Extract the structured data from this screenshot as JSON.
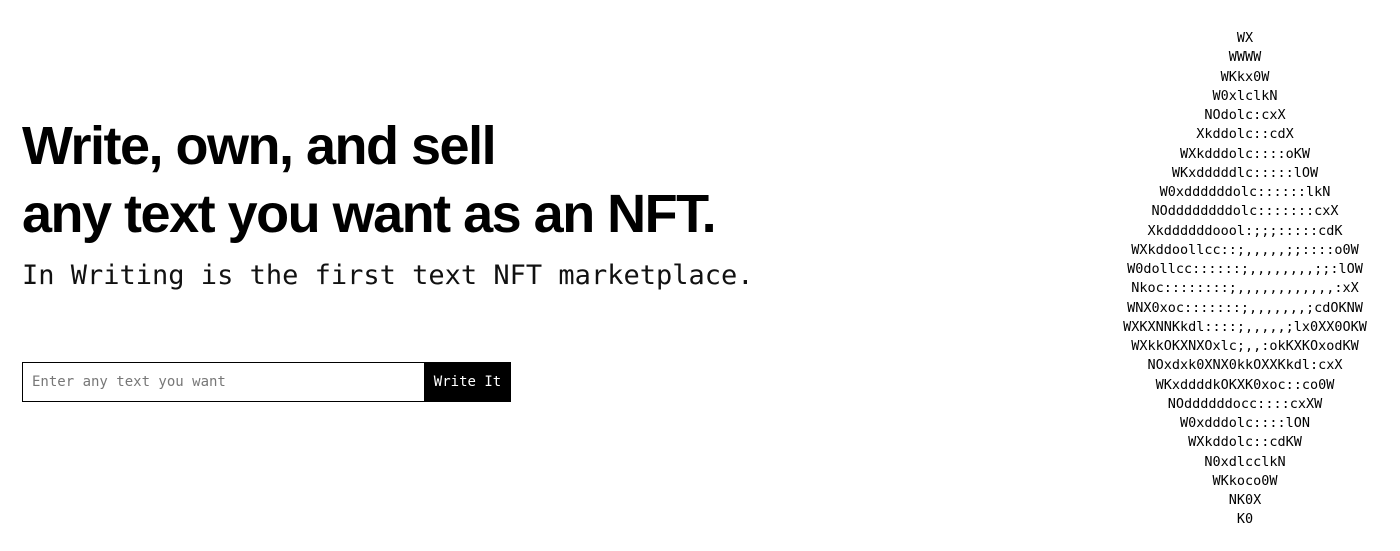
{
  "hero": {
    "headline_line1": "Write, own, and sell",
    "headline_line2": "any text you want as an NFT.",
    "subheadline": "In Writing is the first text NFT marketplace."
  },
  "form": {
    "input_placeholder": "Enter any text you want",
    "input_value": "",
    "button_label": "Write It"
  },
  "ascii_art": {
    "lines": [
      "WX",
      "WWWW",
      "WKkx0W",
      "W0xlclkN",
      "NOdolc:cxX",
      "Xkddolc::cdX",
      "WXkdddolc::::oKW",
      "WKxdddddlc:::::lOW",
      "W0xddddddolc::::::lkN",
      "NOddddddddolc:::::::cxX",
      "Xkddddddoool:;;;:::::cdK",
      "WXkddoollcc::;,,,,,;;::::o0W",
      "W0dollcc::::::;,,,,,,,,;;:lOW",
      "Nkoc::::::::;,,,,,,,,,,,,:xX",
      "WNX0xoc:::::::;,,,,,,,;cdOKNW",
      "WXKXNNKkdl::::;,,,,,;lx0XX0OKW",
      "WXkkOKXNXOxlc;,,:okKXKOxodKW",
      "NOxdxk0XNX0kkOXXKkdl:cxX",
      "WKxddddkOKXK0xoc::co0W",
      "NOddddddocc::::cxXW",
      "W0xdddolc::::lON",
      "WXkddolc::cdKW",
      "N0xdlcclkN",
      "WKkoco0W",
      "NK0X",
      "K0"
    ]
  }
}
